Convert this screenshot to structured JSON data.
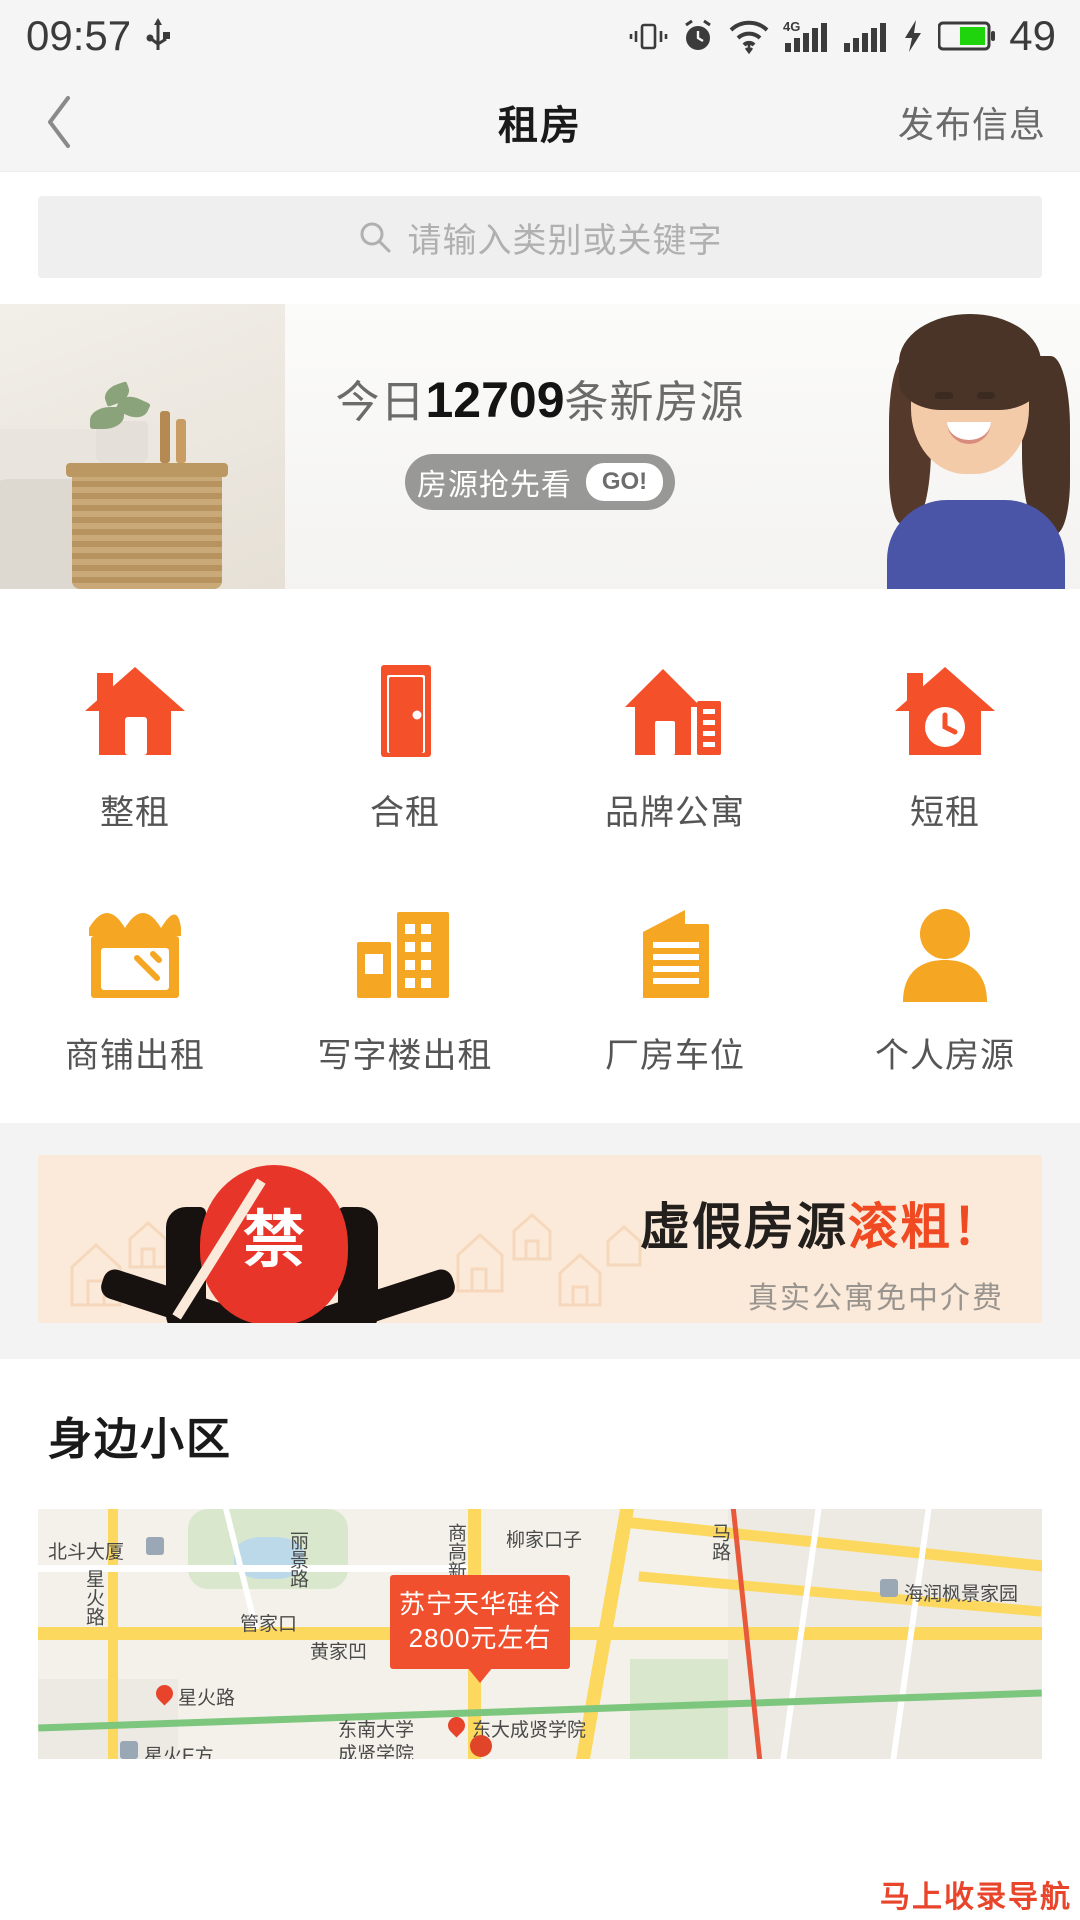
{
  "statusbar": {
    "time": "09:57",
    "battery_percent": "49",
    "icons": [
      "usb-icon",
      "vibrate-icon",
      "alarm-icon",
      "wifi-icon",
      "signal-4g-icon",
      "signal-icon",
      "charging-bolt-icon",
      "battery-icon"
    ]
  },
  "navbar": {
    "back_icon": "chevron-left-icon",
    "title": "租房",
    "action_label": "发布信息"
  },
  "search": {
    "icon": "search-icon",
    "placeholder": "请输入类别或关键字"
  },
  "hero": {
    "prefix": "今日",
    "count": "12709",
    "suffix": "条新房源",
    "pill_label": "房源抢先看",
    "pill_go": "GO!"
  },
  "categories": [
    {
      "label": "整租",
      "icon": "house-icon",
      "color": "#f4502a"
    },
    {
      "label": "合租",
      "icon": "door-icon",
      "color": "#f4502a"
    },
    {
      "label": "品牌公寓",
      "icon": "apartment-house-icon",
      "color": "#f4502a"
    },
    {
      "label": "短租",
      "icon": "house-clock-icon",
      "color": "#f4502a"
    },
    {
      "label": "商铺出租",
      "icon": "shop-icon",
      "color": "#f5a623"
    },
    {
      "label": "写字楼出租",
      "icon": "office-building-icon",
      "color": "#f5a623"
    },
    {
      "label": "厂房车位",
      "icon": "factory-icon",
      "color": "#f5a623"
    },
    {
      "label": "个人房源",
      "icon": "person-icon",
      "color": "#f5a623"
    }
  ],
  "ad": {
    "headline_dark": "虚假房源",
    "headline_accent": "滚粗！",
    "subtitle": "真实公寓免中介费",
    "badge_glyph": "禁",
    "accent_color": "#f04a23",
    "bg_color": "#fbead9"
  },
  "nearby": {
    "title": "身边小区",
    "tooltip": {
      "name": "苏宁天华硅谷",
      "price": "2800元左右"
    },
    "map_labels": [
      "北斗大厦",
      "星火路",
      "黄家凹",
      "东南大学",
      "成贤学院",
      "星火E方",
      "管家口",
      "柳家口子",
      "丽景路",
      "商高新路",
      "马路",
      "海润枫景家园",
      "东大成贤学院",
      "星火路"
    ]
  },
  "watermark": "马上收录导航"
}
